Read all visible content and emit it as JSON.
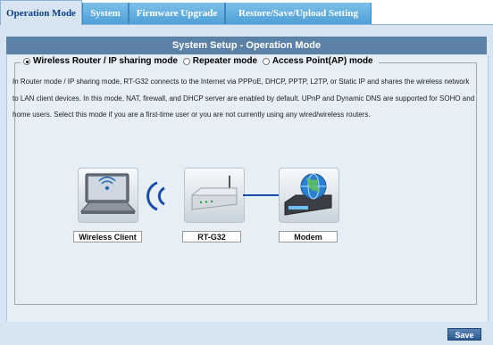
{
  "tabs": [
    {
      "label": "Operation Mode",
      "active": true
    },
    {
      "label": "System",
      "active": false
    },
    {
      "label": "Firmware Upgrade",
      "active": false
    },
    {
      "label": "Restore/Save/Upload Setting",
      "active": false
    }
  ],
  "panel": {
    "title": "System Setup - Operation Mode"
  },
  "modes": [
    {
      "label": "Wireless Router / IP sharing mode",
      "checked": true
    },
    {
      "label": "Repeater mode",
      "checked": false
    },
    {
      "label": "Access Point(AP) mode",
      "checked": false
    }
  ],
  "description": "In Router mode / IP sharing mode, RT-G32 connects to the Internet via PPPoE, DHCP, PPTP, L2TP, or Static IP and shares the wireless network to LAN client devices. In this mode, NAT, firewall, and DHCP server are enabled by default. UPnP and Dynamic DNS are supported for SOHO and home users. Select this mode if you are a first-time user or you are not currently using any wired/wireless routers.",
  "diagram": {
    "client_label": "Wireless Client",
    "router_label": "RT-G32",
    "modem_label": "Modem",
    "icons": [
      "laptop-icon",
      "wireless-signal-icon",
      "router-icon",
      "modem-globe-icon"
    ]
  },
  "save_label": "Save",
  "colors": {
    "tab_inactive": "#5aa8dd",
    "tab_active_text": "#0c3f86",
    "title_bar": "#5b82a6",
    "frame_bg": "#d7e4f1",
    "link_line": "#1b4ea2"
  }
}
